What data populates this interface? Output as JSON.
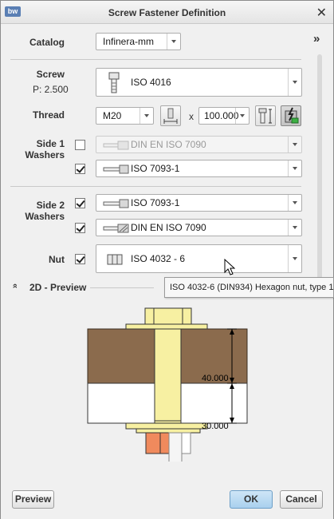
{
  "window": {
    "title": "Screw Fastener Definition",
    "logo": "bw",
    "close": "✕"
  },
  "expand_label": "»",
  "catalog": {
    "label": "Catalog",
    "value": "Infinera-mm"
  },
  "screw": {
    "label": "Screw",
    "pitch": "P: 2.500",
    "value": "ISO 4016"
  },
  "thread": {
    "label": "Thread",
    "size": "M20",
    "times": "x",
    "length": "100.000"
  },
  "side1": {
    "label_line1": "Side 1",
    "label_line2": "Washers",
    "rows": [
      {
        "checked": false,
        "value": "DIN EN ISO 7090",
        "disabled": true
      },
      {
        "checked": true,
        "value": "ISO 7093-1",
        "disabled": false
      }
    ]
  },
  "side2": {
    "label_line1": "Side 2",
    "label_line2": "Washers",
    "rows": [
      {
        "checked": true,
        "value": "ISO 7093-1"
      },
      {
        "checked": true,
        "value": "DIN EN ISO 7090"
      }
    ]
  },
  "nut": {
    "label": "Nut",
    "checked": true,
    "value": "ISO 4032 - 6"
  },
  "preview_section": {
    "collapse_icon": "»",
    "label": "2D - Preview"
  },
  "tooltip": "ISO 4032-6 (DIN934) Hexagon nut, type 1",
  "dimensions": {
    "upper": "40.000",
    "lower": "30.000"
  },
  "buttons": {
    "preview": "Preview",
    "ok": "OK",
    "cancel": "Cancel"
  },
  "colors": {
    "plate_brown": "#8b6b4d",
    "bolt_yellow": "#f7f0a2",
    "nut_orange": "#f08a5d",
    "ok_blue": "#a9d0ee"
  }
}
